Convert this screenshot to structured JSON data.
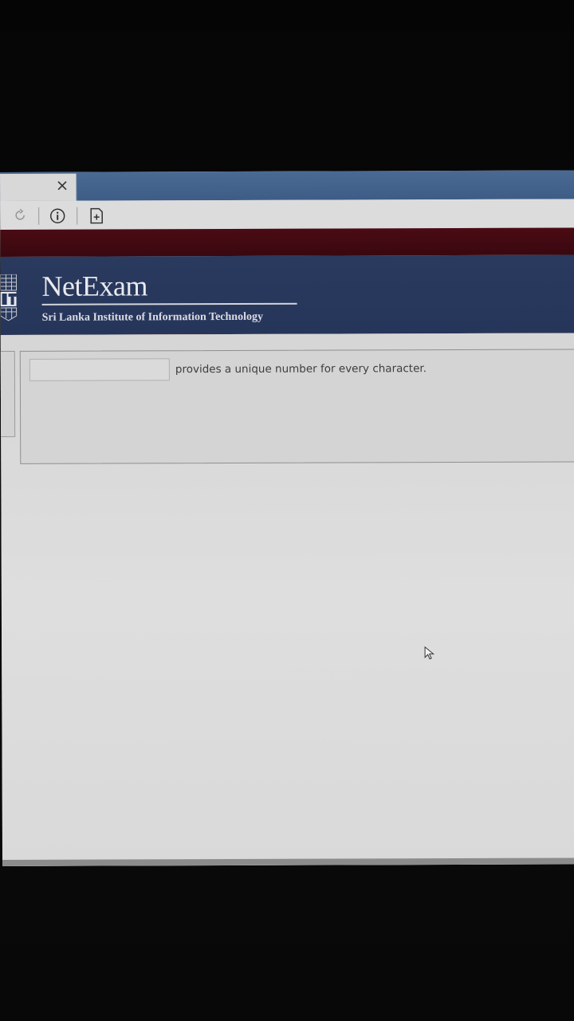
{
  "browser": {
    "tab": {
      "close_icon": "close-icon"
    },
    "address_bar": {
      "icons": [
        "reload-icon",
        "info-icon",
        "page-icon"
      ]
    }
  },
  "header": {
    "brand_title": "NetExam",
    "brand_subtitle": "Sri Lanka Institute of Information Technology",
    "logo_icon": "sliit-emblem-icon"
  },
  "question": {
    "answer_value": "",
    "text": "provides a unique number for every character."
  },
  "colors": {
    "tab_strip": "#3d5c86",
    "maroon_band": "#4a0b14",
    "header_bg": "#2a3a5e",
    "header_accent": "#b5653a",
    "content_bg": "#d6d6d6"
  }
}
